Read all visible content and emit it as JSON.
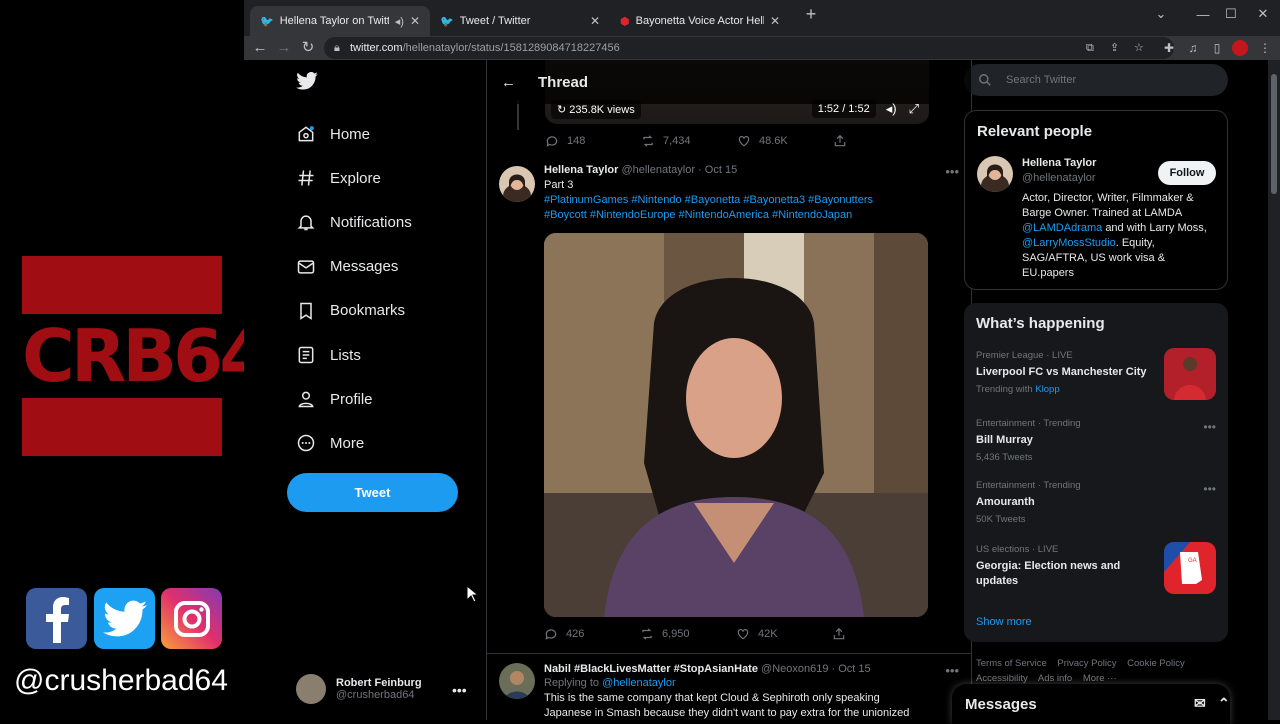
{
  "overlay": {
    "logo_text": "CRB64",
    "social_handle": "@crusherbad64"
  },
  "browser": {
    "tabs": [
      {
        "title": "Hellena Taylor on Twitter: \"Fr...",
        "active": true
      },
      {
        "title": "Tweet / Twitter",
        "active": false
      },
      {
        "title": "Bayonetta Voice Actor Hellena Ta",
        "active": false
      }
    ],
    "url_host": "twitter.com",
    "url_path": "/hellenataylor/status/1581289084718227456"
  },
  "sidebar": {
    "items": [
      {
        "label": "Home"
      },
      {
        "label": "Explore"
      },
      {
        "label": "Notifications"
      },
      {
        "label": "Messages"
      },
      {
        "label": "Bookmarks"
      },
      {
        "label": "Lists"
      },
      {
        "label": "Profile"
      },
      {
        "label": "More"
      }
    ],
    "tweet_button": "Tweet",
    "account": {
      "name": "Robert Feinburg",
      "handle": "@crusherbad64"
    }
  },
  "thread": {
    "title": "Thread",
    "prev_video": {
      "views": "235.8K views",
      "time": "1:52 / 1:52"
    },
    "prev_actions": {
      "replies": "148",
      "retweets": "7,434",
      "likes": "48.6K"
    },
    "tweet": {
      "name": "Hellena Taylor",
      "handle": "@hellenataylor",
      "date": "Oct 15",
      "text_line1": "Part 3",
      "hashtags_line1": "#PlatinumGames #Nintendo #Bayonetta #Bayonetta3 #Bayonutters",
      "hashtags_line2": "#Boycott #NintendoEurope #NintendoAmerica #NintendoJapan",
      "replies": "426",
      "retweets": "6,950",
      "likes": "42K"
    },
    "reply": {
      "name": "Nabil #BlackLivesMatter #StopAsianHate",
      "handle": "@Neoxon619",
      "date": "Oct 15",
      "replying_prefix": "Replying to",
      "replying_to": "@hellenataylor",
      "text": "This is the same company that kept Cloud & Sephiroth only speaking Japanese in Smash because they didn't want to pay extra for the unionized"
    }
  },
  "right": {
    "search_placeholder": "Search Twitter",
    "relevant": {
      "title": "Relevant people",
      "name": "Hellena Taylor",
      "handle": "@hellenataylor",
      "follow": "Follow",
      "bio_1": "Actor, Director, Writer, Filmmaker & Barge Owner. Trained at LAMDA",
      "bio_link1": "@LAMDAdrama",
      "bio_2": "and with Larry Moss,",
      "bio_link2": "@LarryMossStudio",
      "bio_3": ". Equity, SAG/AFTRA, US work visa & EU.papers"
    },
    "happening": {
      "title": "What’s happening",
      "trends": [
        {
          "meta": "Premier League · LIVE",
          "title": "Liverpool FC vs Manchester City",
          "sub_prefix": "Trending with",
          "sub_link": "Klopp"
        },
        {
          "meta": "Entertainment · Trending",
          "title": "Bill Murray",
          "sub": "5,436 Tweets"
        },
        {
          "meta": "Entertainment · Trending",
          "title": "Amouranth",
          "sub": "50K Tweets"
        },
        {
          "meta": "US elections · LIVE",
          "title": "Georgia: Election news and updates"
        }
      ],
      "show_more": "Show more"
    },
    "footer": [
      "Terms of Service",
      "Privacy Policy",
      "Cookie Policy",
      "Accessibility",
      "Ads info",
      "More ···"
    ],
    "messages_drawer": "Messages"
  },
  "colors": {
    "accent": "#1d9bf0",
    "logo_red": "#a00e13"
  }
}
